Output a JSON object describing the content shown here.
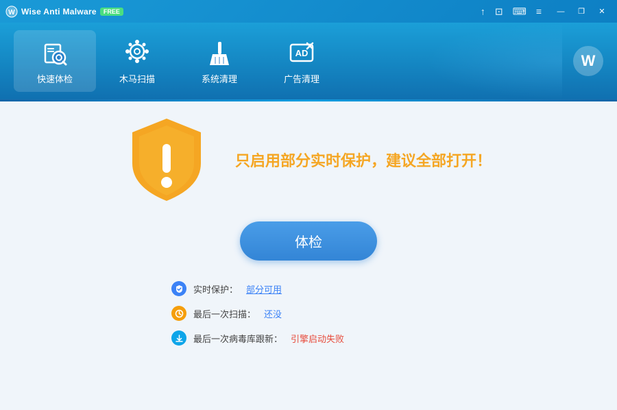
{
  "titlebar": {
    "app_name": "Wise Anti Malware",
    "free_badge": "FREE",
    "extra_icons": [
      "↑",
      "⊡",
      "⌨",
      "≡"
    ],
    "window_controls": [
      "—",
      "❐",
      "✕"
    ]
  },
  "nav": {
    "items": [
      {
        "id": "quick-scan",
        "label": "快速体检",
        "active": true
      },
      {
        "id": "trojan-scan",
        "label": "木马扫描",
        "active": false
      },
      {
        "id": "system-clean",
        "label": "系统清理",
        "active": false
      },
      {
        "id": "ad-clean",
        "label": "广告清理",
        "active": false
      }
    ],
    "avatar_letter": "W"
  },
  "main": {
    "warning_text": "只启用部分实时保护，建议全部打开！",
    "scan_button_label": "体检",
    "status_items": [
      {
        "id": "realtime",
        "label": "实时保护：",
        "value": "部分可用",
        "value_class": "partial",
        "icon_type": "shield"
      },
      {
        "id": "last-scan",
        "label": "最后一次扫描：",
        "value": "还没",
        "value_class": "none",
        "icon_type": "clock"
      },
      {
        "id": "last-update",
        "label": "最后一次病毒库跟新：",
        "value": "引擎启动失败",
        "value_class": "error",
        "icon_type": "download"
      }
    ]
  }
}
